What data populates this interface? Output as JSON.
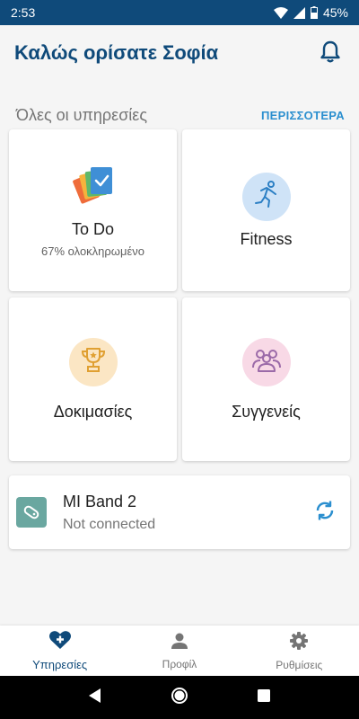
{
  "status_bar": {
    "time": "2:53",
    "battery": "45%"
  },
  "header": {
    "title": "Καλώς ορίσατε Σοφία"
  },
  "services": {
    "title": "Όλες οι υπηρεσίες",
    "more_label": "ΠΕΡΙΣΣΟΤΕΡΑ",
    "cards": [
      {
        "label": "To Do",
        "subtitle": "67% ολοκληρωμένο",
        "icon": "todo-cards-icon"
      },
      {
        "label": "Fitness",
        "icon": "running-person-icon"
      },
      {
        "label": "Δοκιμασίες",
        "icon": "trophy-icon"
      },
      {
        "label": "Συγγενείς",
        "icon": "relatives-icon"
      }
    ]
  },
  "device": {
    "name": "MI Band 2",
    "status": "Not connected"
  },
  "bottom_nav": [
    {
      "label": "Υπηρεσίες",
      "icon": "heart-plus-icon",
      "active": true
    },
    {
      "label": "Προφίλ",
      "icon": "person-icon"
    },
    {
      "label": "Ρυθμίσεις",
      "icon": "gear-icon"
    }
  ],
  "colors": {
    "primary": "#0f4a7a",
    "accent": "#2b8fcf",
    "background": "#f5f5f5"
  }
}
